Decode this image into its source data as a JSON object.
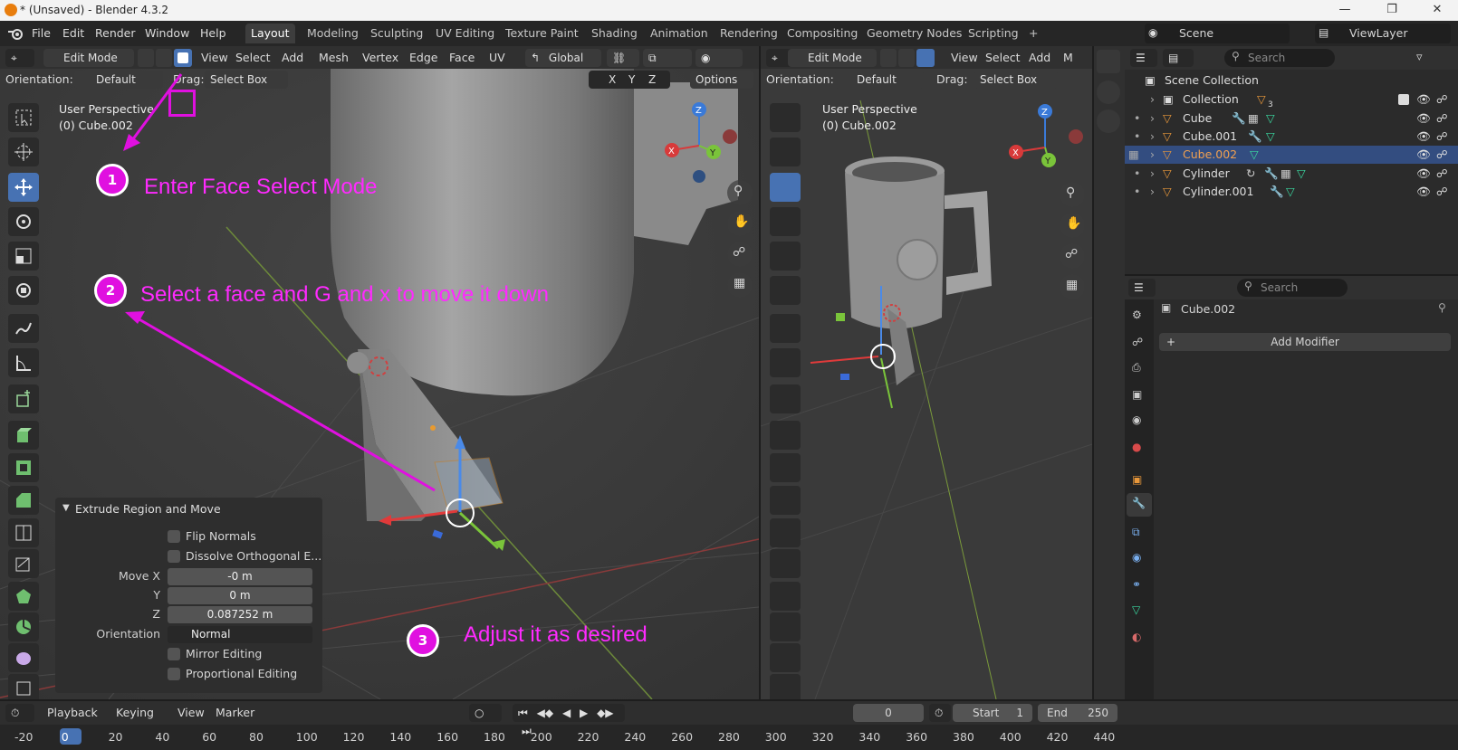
{
  "window": {
    "title": "* (Unsaved) - Blender 4.3.2",
    "minimize": "—",
    "maximize": "❐",
    "close": "✕"
  },
  "menubar": {
    "items": [
      "File",
      "Edit",
      "Render",
      "Window",
      "Help"
    ],
    "tabs": [
      "Layout",
      "Modeling",
      "Sculpting",
      "UV Editing",
      "Texture Paint",
      "Shading",
      "Animation",
      "Rendering",
      "Compositing",
      "Geometry Nodes",
      "Scripting"
    ],
    "active_tab": "Layout",
    "add_tab": "+",
    "scene_label": "Scene",
    "viewlayer_label": "ViewLayer"
  },
  "viewport_left": {
    "mode": "Edit Mode",
    "menus": [
      "View",
      "Select",
      "Add",
      "Mesh",
      "Vertex",
      "Edge",
      "Face",
      "UV"
    ],
    "transform_orientation": "Global",
    "orientation_label": "Orientation:",
    "orientation_value": "Default",
    "drag_label": "Drag:",
    "drag_value": "Select Box",
    "axes": [
      "X",
      "Y",
      "Z"
    ],
    "options_label": "Options",
    "perspective": "User Perspective",
    "object": "(0) Cube.002"
  },
  "viewport_right": {
    "mode": "Edit Mode",
    "menus": [
      "View",
      "Select",
      "Add",
      "M"
    ],
    "orientation_label": "Orientation:",
    "orientation_value": "Default",
    "drag_label": "Drag:",
    "drag_value": "Select Box",
    "perspective": "User Perspective",
    "object": "(0) Cube.002"
  },
  "gizmo_labels": {
    "x": "X",
    "y": "Y",
    "z": "Z"
  },
  "annotations": [
    {
      "num": "1",
      "text": "Enter Face Select Mode"
    },
    {
      "num": "2",
      "text": "Select a face and G and x to move it down"
    },
    {
      "num": "3",
      "text": "Adjust it as desired"
    }
  ],
  "operator_panel": {
    "title": "Extrude Region and Move",
    "flip_normals": "Flip Normals",
    "dissolve": "Dissolve Orthogonal E...",
    "move_x_label": "Move X",
    "move_x": "-0 m",
    "y_label": "Y",
    "y": "0 m",
    "z_label": "Z",
    "z": "0.087252 m",
    "orientation_label": "Orientation",
    "orientation_value": "Normal",
    "mirror": "Mirror Editing",
    "proportional": "Proportional Editing"
  },
  "outliner": {
    "search_placeholder": "Search",
    "scene_collection": "Scene Collection",
    "rows": [
      {
        "name": "Collection",
        "badge": "3"
      },
      {
        "name": "Cube"
      },
      {
        "name": "Cube.001"
      },
      {
        "name": "Cube.002"
      },
      {
        "name": "Cylinder"
      },
      {
        "name": "Cylinder.001"
      }
    ],
    "selected": "Cube.002"
  },
  "properties": {
    "search_placeholder": "Search",
    "object_name": "Cube.002",
    "add_modifier": "Add Modifier"
  },
  "timeline": {
    "playback": "Playback",
    "keying": "Keying",
    "view": "View",
    "marker": "Marker",
    "current_frame": "0",
    "start_label": "Start",
    "start": "1",
    "end_label": "End",
    "end": "250",
    "ticks": [
      "-20",
      "0",
      "20",
      "40",
      "60",
      "80",
      "100",
      "120",
      "140",
      "160",
      "180",
      "200",
      "220",
      "240",
      "260",
      "280",
      "300",
      "320",
      "340",
      "360",
      "380",
      "400",
      "420",
      "440"
    ]
  },
  "colors": {
    "accent_blue": "#4772b3",
    "annotation": "#e010e0",
    "selected_row": "#334d80",
    "orange_object": "#e8973a"
  }
}
